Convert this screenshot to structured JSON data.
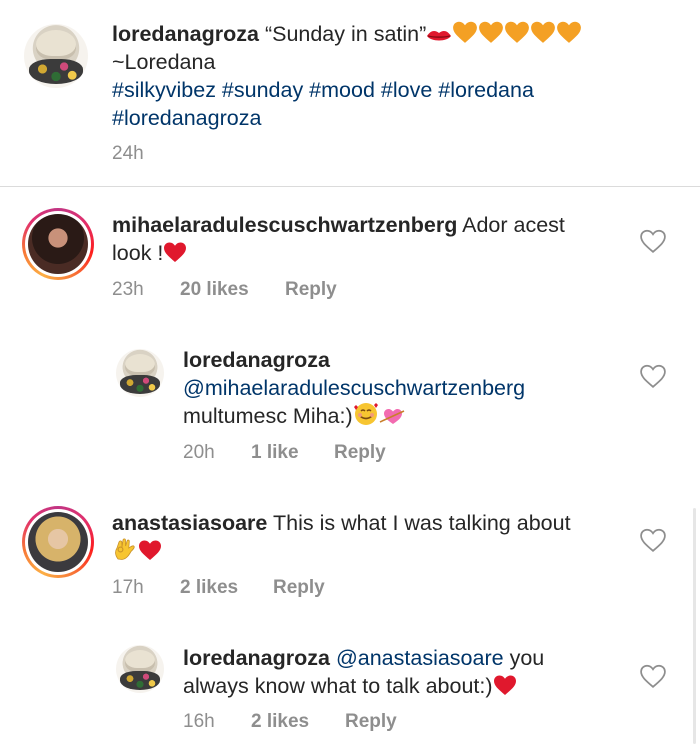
{
  "caption": {
    "username": "loredanagroza",
    "text": "“Sunday in satin”",
    "line2": "~Loredana",
    "hashtags_line1": "#silkyvibez #sunday #mood #love #loredana",
    "hashtags_line2": "#loredanagroza",
    "time": "24h",
    "emojis": [
      "lips-emoji",
      "orange-heart",
      "orange-heart",
      "orange-heart",
      "orange-heart",
      "orange-heart"
    ]
  },
  "comments": [
    {
      "username": "mihaelaradulescuschwartzenberg",
      "text_line1": "Ador acest",
      "text_line2": "look !",
      "time": "23h",
      "likes": "20 likes",
      "reply": "Reply"
    },
    {
      "username": "loredanagroza",
      "mention": "@mihaelaradulescuschwartzenberg",
      "text_line2": "multumesc Miha:)",
      "time": "20h",
      "likes": "1 like",
      "reply": "Reply"
    },
    {
      "username": "anastasiasoare",
      "text_line1": "This is what I was talking about",
      "time": "17h",
      "likes": "2 likes",
      "reply": "Reply"
    },
    {
      "username": "loredanagroza",
      "mention": "@anastasiasoare",
      "text_line1": "you",
      "text_line2": "always know what to talk about:)",
      "time": "16h",
      "likes": "2 likes",
      "reply": "Reply"
    }
  ],
  "colors": {
    "hashtag": "#003569",
    "meta": "#8e8e8e",
    "heart_red": "#e0182d",
    "orange_heart": "#f4a024",
    "divider": "#dbdbdb"
  }
}
